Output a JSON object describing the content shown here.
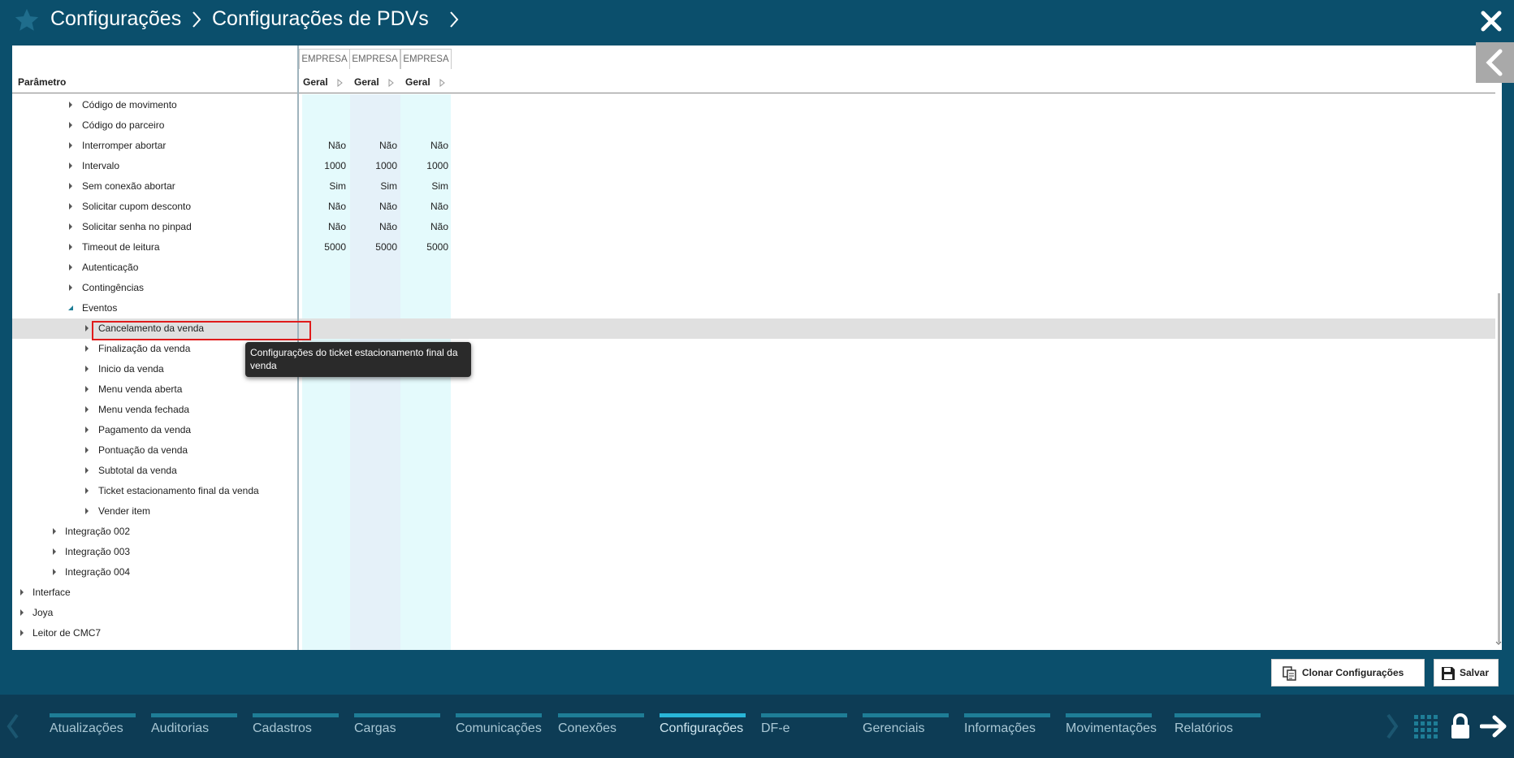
{
  "header": {
    "breadcrumb": [
      "Configurações",
      "Configurações de PDVs"
    ]
  },
  "grid": {
    "param_header": "Parâmetro",
    "columns": [
      {
        "scope": "EMPRESA",
        "group": "Geral"
      },
      {
        "scope": "EMPRESA",
        "group": "Geral"
      },
      {
        "scope": "EMPRESA",
        "group": "Geral"
      }
    ],
    "rows": [
      {
        "label": "Código de movimento",
        "values": [
          "",
          "",
          ""
        ]
      },
      {
        "label": "Código do parceiro",
        "values": [
          "",
          "",
          ""
        ]
      },
      {
        "label": "Interromper abortar",
        "values": [
          "Não",
          "Não",
          "Não"
        ]
      },
      {
        "label": "Intervalo",
        "values": [
          "1000",
          "1000",
          "1000"
        ]
      },
      {
        "label": "Sem conexão abortar",
        "values": [
          "Sim",
          "Sim",
          "Sim"
        ]
      },
      {
        "label": "Solicitar cupom desconto",
        "values": [
          "Não",
          "Não",
          "Não"
        ]
      },
      {
        "label": "Solicitar senha no pinpad",
        "values": [
          "Não",
          "Não",
          "Não"
        ]
      },
      {
        "label": "Timeout de leitura",
        "values": [
          "5000",
          "5000",
          "5000"
        ]
      },
      {
        "label": "Autenticação",
        "values": [
          "",
          "",
          ""
        ]
      },
      {
        "label": "Contingências",
        "values": [
          "",
          "",
          ""
        ]
      },
      {
        "label": "Eventos",
        "values": [
          "",
          "",
          ""
        ]
      },
      {
        "label": "Cancelamento da venda",
        "values": [
          "",
          "",
          ""
        ]
      },
      {
        "label": "Finalização da venda",
        "values": [
          "",
          "",
          ""
        ]
      },
      {
        "label": "Inicio da venda",
        "values": [
          "",
          "",
          ""
        ]
      },
      {
        "label": "Menu venda aberta",
        "values": [
          "",
          "",
          ""
        ]
      },
      {
        "label": "Menu venda fechada",
        "values": [
          "",
          "",
          ""
        ]
      },
      {
        "label": "Pagamento da venda",
        "values": [
          "",
          "",
          ""
        ]
      },
      {
        "label": "Pontuação da venda",
        "values": [
          "",
          "",
          ""
        ]
      },
      {
        "label": "Subtotal da venda",
        "values": [
          "",
          "",
          ""
        ]
      },
      {
        "label": "Ticket estacionamento final da venda",
        "values": [
          "",
          "",
          ""
        ]
      },
      {
        "label": "Vender item",
        "values": [
          "",
          "",
          ""
        ]
      },
      {
        "label": "Integração 002",
        "values": [
          "",
          "",
          ""
        ]
      },
      {
        "label": "Integração 003",
        "values": [
          "",
          "",
          ""
        ]
      },
      {
        "label": "Integração 004",
        "values": [
          "",
          "",
          ""
        ]
      },
      {
        "label": "Interface",
        "values": [
          "",
          "",
          ""
        ]
      },
      {
        "label": "Joya",
        "values": [
          "",
          "",
          ""
        ]
      },
      {
        "label": "Leitor de CMC7",
        "values": [
          "",
          "",
          ""
        ]
      }
    ]
  },
  "tooltip": "Configurações do ticket estacionamento final da venda",
  "actions": {
    "clone_label": "Clonar Configurações",
    "save_label": "Salvar"
  },
  "nav": {
    "items": [
      "Atualizações",
      "Auditorias",
      "Cadastros",
      "Cargas",
      "Comunicações",
      "Conexões",
      "Configurações",
      "DF-e",
      "Gerenciais",
      "Informações",
      "Movimentações",
      "Relatórios"
    ],
    "active": "Configurações"
  },
  "colors": {
    "background": "#0b4f6c",
    "bottom_bar": "#0d3c55",
    "nav_accent": "#1e7d96",
    "nav_active_accent": "#29b6d8",
    "column_tint_a": "#e4fafc",
    "column_tint_b": "#e5f1f9",
    "selection_border": "#e01b1b",
    "selected_row": "#e0e0e0"
  }
}
